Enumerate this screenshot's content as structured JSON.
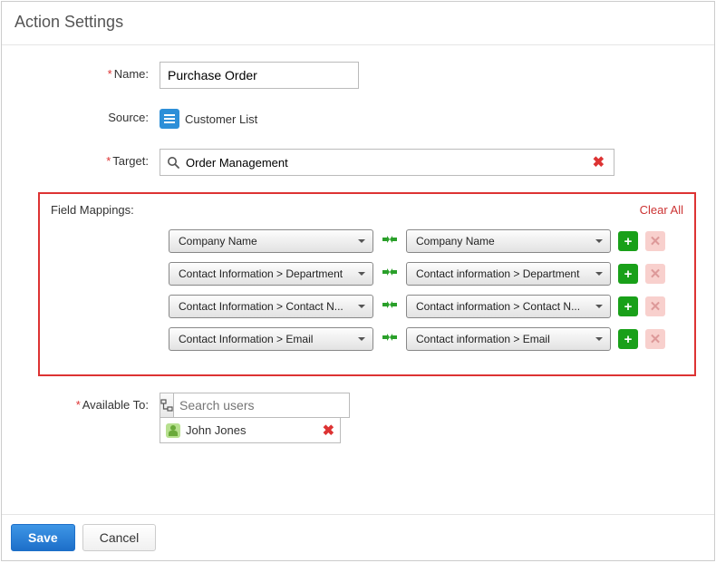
{
  "title": "Action Settings",
  "labels": {
    "name": "Name:",
    "source": "Source:",
    "target": "Target:",
    "field_mappings": "Field Mappings:",
    "available_to": "Available To:"
  },
  "name_value": "Purchase Order",
  "source_app": {
    "icon": "list-app-icon",
    "name": "Customer List"
  },
  "target_value": "Order Management",
  "clear_all": "Clear All",
  "mappings": [
    {
      "from": "Company Name",
      "to": "Company Name"
    },
    {
      "from": "Contact Information > Department",
      "to": "Contact information > Department"
    },
    {
      "from": "Contact Information > Contact N...",
      "to": "Contact information > Contact N..."
    },
    {
      "from": "Contact Information > Email",
      "to": "Contact information > Email"
    }
  ],
  "user_search_placeholder": "Search users",
  "selected_users": [
    {
      "name": "John Jones"
    }
  ],
  "buttons": {
    "save": "Save",
    "cancel": "Cancel"
  }
}
